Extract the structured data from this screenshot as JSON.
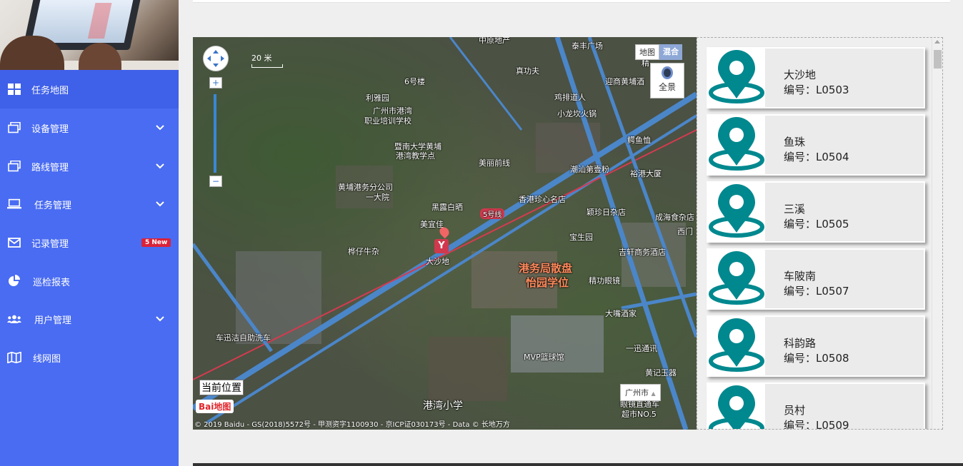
{
  "sidebar": {
    "items": [
      {
        "label": "任务地图",
        "icon": "grid-icon",
        "active": true
      },
      {
        "label": "设备管理",
        "icon": "windows-icon",
        "expandable": true
      },
      {
        "label": "路线管理",
        "icon": "windows-icon",
        "expandable": true
      },
      {
        "label": "任务管理",
        "icon": "laptop-icon",
        "expandable": true
      },
      {
        "label": "记录管理",
        "icon": "envelope-icon",
        "badge": "5 New"
      },
      {
        "label": "巡检报表",
        "icon": "pie-chart-icon"
      },
      {
        "label": "用户管理",
        "icon": "users-icon",
        "expandable": true
      },
      {
        "label": "线网图",
        "icon": "map-icon"
      }
    ]
  },
  "map": {
    "scale_label": "20 米",
    "maptype": {
      "map": "地图",
      "hybrid": "混合",
      "selected": "混合"
    },
    "panorama_label": "全景",
    "current_position_label": "当前位置",
    "city_label": "广州市",
    "baidu_logo": "Bai地图",
    "copyright": "© 2019 Baidu - GS(2018)5572号 - 甲测资字1100930 - 京ICP证030173号 - Data © 长地万方",
    "station_name": "大沙地",
    "line_label": "5号线",
    "pois": [
      "中原地产",
      "泰丰广场",
      "真功夫",
      "迎商黄埔酒",
      "利雅园",
      "鸡排道人",
      "广州市港湾",
      "职业培训学校",
      "小龙坎火锅",
      "鳄鱼恤",
      "暨南大学黄埔",
      "港湾教学点",
      "美丽前线",
      "潮汕第壹粉",
      "裕港大厦",
      "黄埔港务分公司",
      "一大院",
      "黑露白晒",
      "香港珍心名店",
      "颖珍日杂店",
      "成海食杂店",
      "美宜佳",
      "宝生园",
      "西门",
      "桦仔牛杂",
      "吉轩商务酒店",
      "港务局散盘",
      "怡园学位",
      "精功眼镜",
      "大嘴酒家",
      "车迅洁自助洗车",
      "一迅通讯",
      "MVP篮球馆",
      "黄记玉器",
      "港湾小学",
      "眼镜直通车",
      "超市NO.5",
      "6号楼",
      "精"
    ]
  },
  "stations": [
    {
      "name": "大沙地",
      "code_label": "编号：",
      "code": "L0503"
    },
    {
      "name": "鱼珠",
      "code_label": "编号：",
      "code": "L0504"
    },
    {
      "name": "三溪",
      "code_label": "编号：",
      "code": "L0505"
    },
    {
      "name": "车陂南",
      "code_label": "编号：",
      "code": "L0507"
    },
    {
      "name": "科韵路",
      "code_label": "编号：",
      "code": "L0508"
    },
    {
      "name": "员村",
      "code_label": "编号：",
      "code": "L0509"
    }
  ],
  "colors": {
    "sidebar": "#4a6cf2",
    "sidebar_active": "#3f60e8",
    "pin": "#00888f",
    "badge": "#d9233a"
  }
}
